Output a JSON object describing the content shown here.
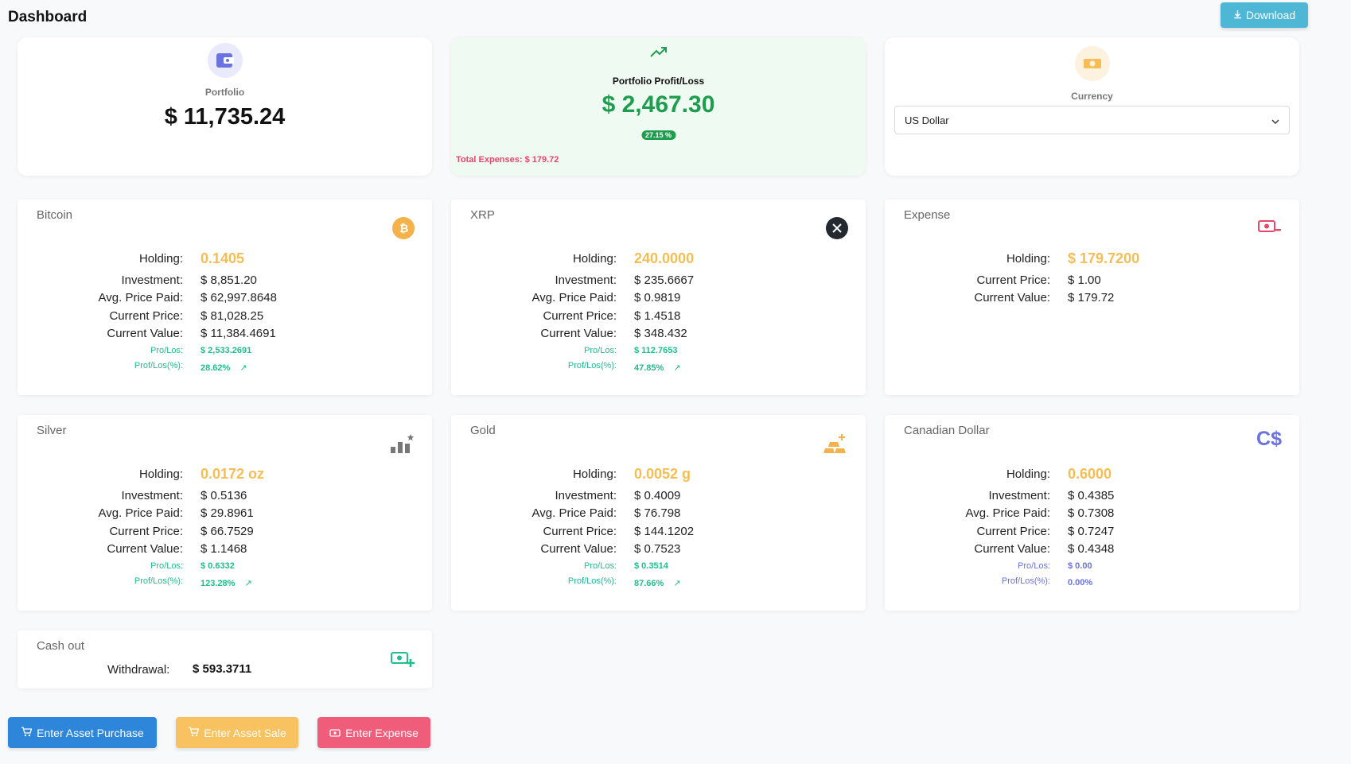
{
  "header": {
    "title": "Dashboard",
    "download_label": "Download"
  },
  "summary": {
    "portfolio": {
      "label": "Portfolio",
      "value": "$ 11,735.24",
      "icon": "wallet-icon"
    },
    "profit": {
      "label": "Portfolio Profit/Loss",
      "value": "$ 2,467.30",
      "percent": "27.15 %",
      "expenses_note": "Total Expenses: $ 179.72",
      "icon": "trending-up-icon"
    },
    "currency": {
      "label": "Currency",
      "selected": "US Dollar",
      "icon": "money-bill-icon"
    }
  },
  "labels": {
    "holding": "Holding:",
    "investment": "Investment:",
    "avg_price": "Avg. Price Paid:",
    "current_price": "Current Price:",
    "current_value": "Current Value:",
    "pro_los": "Pro/Los:",
    "prof_los_pct": "Prof/Los(%):",
    "arrow": "↗"
  },
  "assets": {
    "bitcoin": {
      "title": "Bitcoin",
      "holding": "0.1405",
      "investment": "$ 8,851.20",
      "avg_price": "$ 62,997.8648",
      "current_price": "$ 81,028.25",
      "current_value": "$ 11,384.4691",
      "pro_los": "$ 2,533.2691",
      "prof_los_pct": "28.62%"
    },
    "xrp": {
      "title": "XRP",
      "holding": "240.0000",
      "investment": "$ 235.6667",
      "avg_price": "$ 0.9819",
      "current_price": "$ 1.4518",
      "current_value": "$ 348.432",
      "pro_los": "$ 112.7653",
      "prof_los_pct": "47.85%"
    },
    "expense": {
      "title": "Expense",
      "holding": "$ 179.7200",
      "current_price": "$ 1.00",
      "current_value": "$ 179.72"
    },
    "silver": {
      "title": "Silver",
      "holding": "0.0172 oz",
      "investment": "$ 0.5136",
      "avg_price": "$ 29.8961",
      "current_price": "$ 66.7529",
      "current_value": "$ 1.1468",
      "pro_los": "$ 0.6332",
      "prof_los_pct": "123.28%"
    },
    "gold": {
      "title": "Gold",
      "holding": "0.0052 g",
      "investment": "$ 0.4009",
      "avg_price": "$ 76.798",
      "current_price": "$ 144.1202",
      "current_value": "$ 0.7523",
      "pro_los": "$ 0.3514",
      "prof_los_pct": "87.66%"
    },
    "cad": {
      "title": "Canadian Dollar",
      "icon_text": "C$",
      "holding": "0.6000",
      "investment": "$ 0.4385",
      "avg_price": "$ 0.7308",
      "current_price": "$ 0.7247",
      "current_value": "$ 0.4348",
      "pro_los": "$ 0.00",
      "prof_los_pct": "0.00%"
    }
  },
  "cashout": {
    "title": "Cash out",
    "label": "Withdrawal:",
    "value": "$ 593.3711"
  },
  "actions": {
    "purchase": "Enter Asset Purchase",
    "sale": "Enter Asset Sale",
    "expense": "Enter Expense"
  },
  "colors": {
    "accent_green": "#1e9d4f",
    "holding_orange": "#f6bd52",
    "profit_green": "#1dbf8c",
    "expense_red": "#e6476c",
    "neutral_blue": "#6a73e0"
  }
}
